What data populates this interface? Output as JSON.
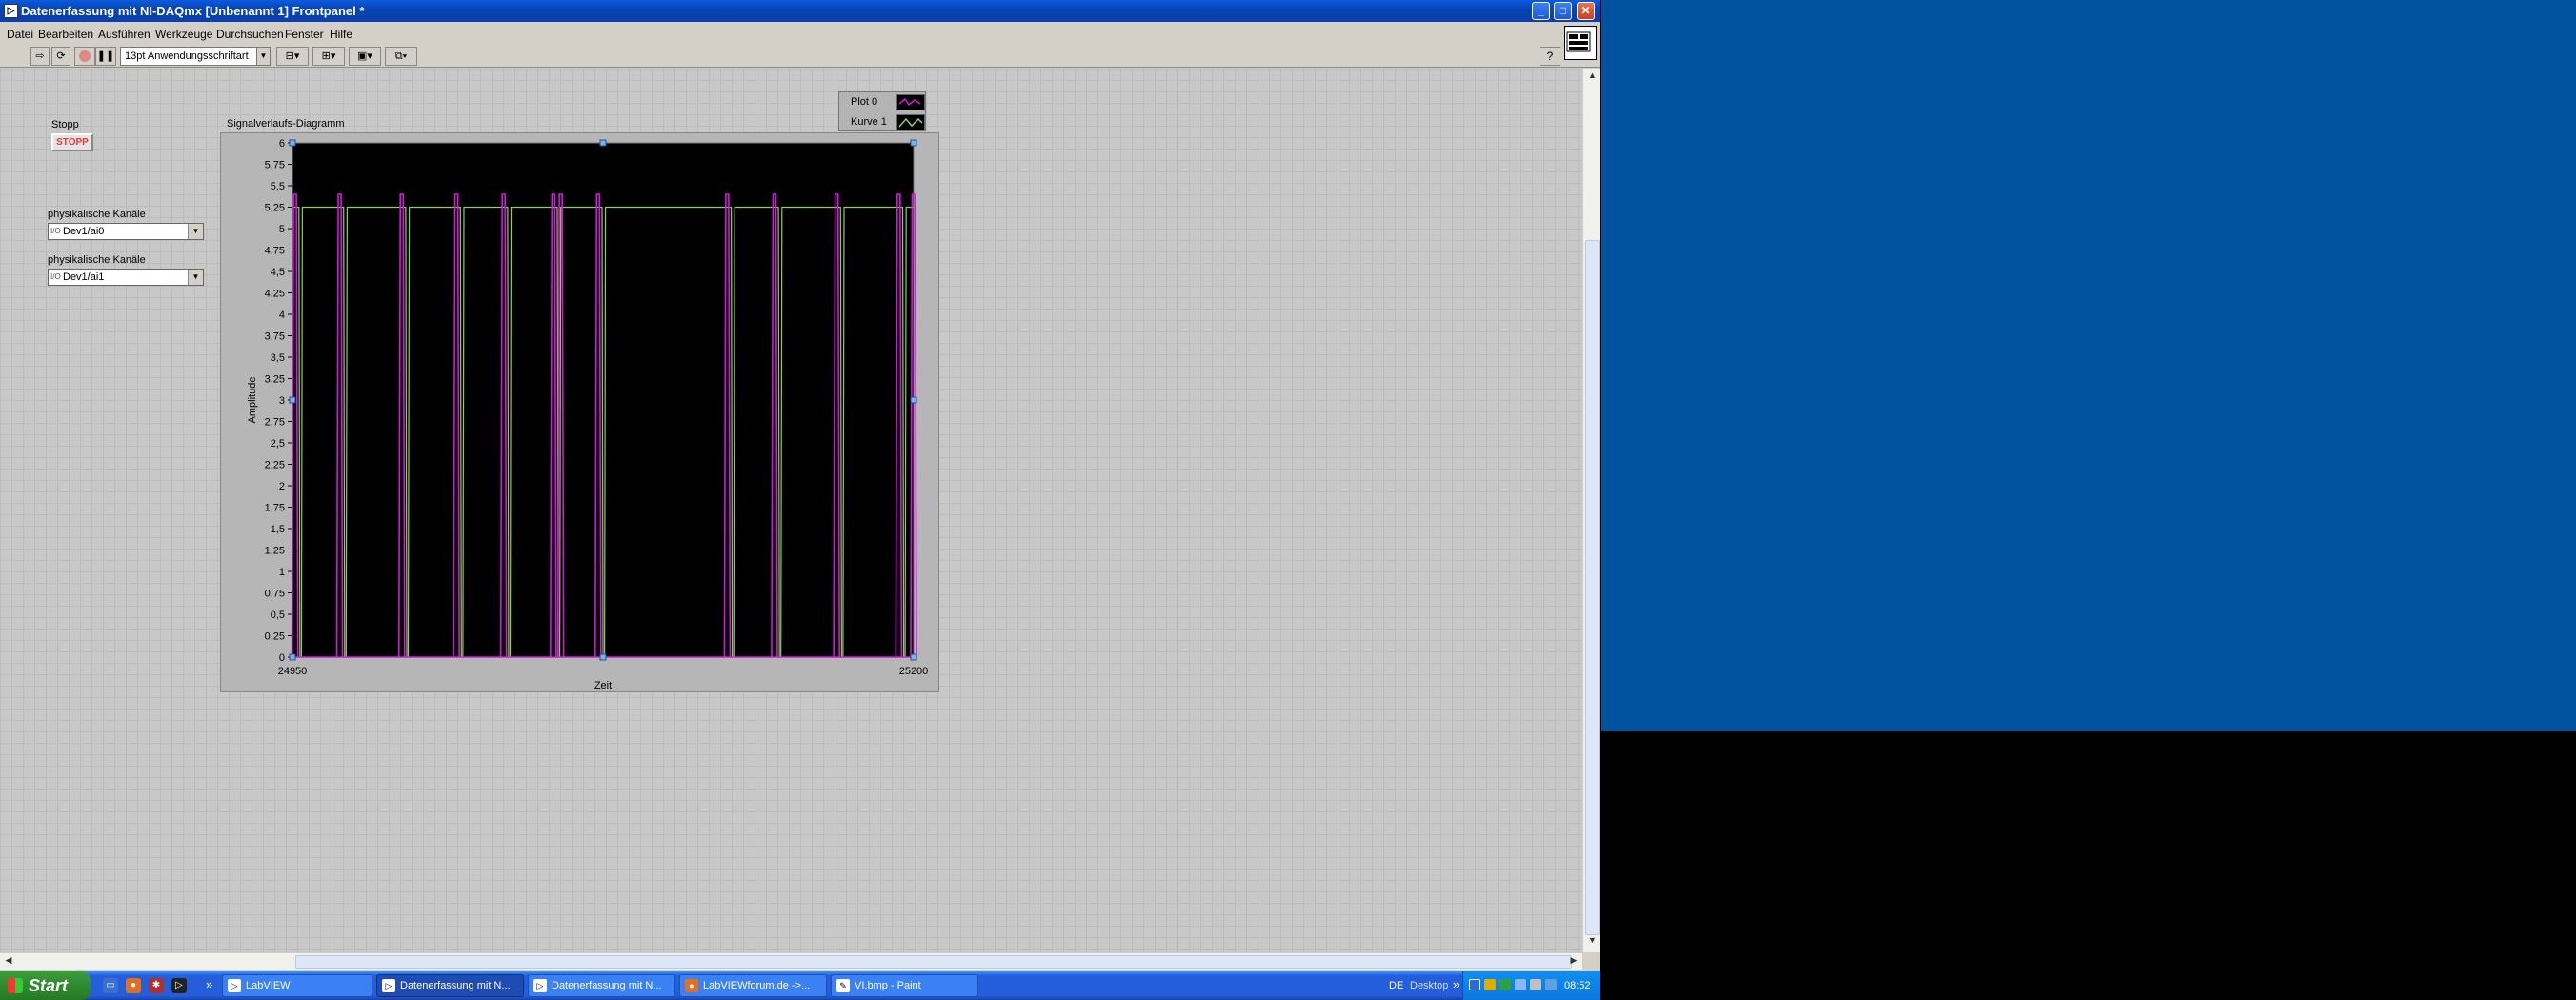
{
  "window": {
    "title": "Datenerfassung mit NI-DAQmx [Unbenannt 1] Frontpanel *",
    "controls": {
      "minimize": "_",
      "maximize": "□",
      "close": "✕"
    }
  },
  "menu": [
    "Datei",
    "Bearbeiten",
    "Ausführen",
    "Werkzeuge",
    "Durchsuchen",
    "Fenster",
    "Hilfe"
  ],
  "toolbar": {
    "font": "13pt Anwendungsschriftart",
    "icons": [
      "run-arrow-icon",
      "run-continuous-icon",
      "abort-icon",
      "pause-icon",
      "align-icon",
      "distribute-icon",
      "resize-icon",
      "reorder-icon"
    ],
    "help": "?"
  },
  "front_panel": {
    "stop_label": "Stopp",
    "stop_button": "STOPP",
    "channel1_label": "physikalische Kanäle",
    "channel1_value": "Dev1/ai0",
    "channel2_label": "physikalische Kanäle",
    "channel2_value": "Dev1/ai1",
    "io_symbol": "I/O"
  },
  "graph": {
    "label": "Signalverlaufs-Diagramm",
    "legend": [
      {
        "name": "Plot 0",
        "color": "#d01adc"
      },
      {
        "name": "Kurve 1",
        "color": "#8ed05a"
      }
    ]
  },
  "chart_data": {
    "type": "line",
    "title": "Signalverlaufs-Diagramm",
    "xlabel": "Zeit",
    "ylabel": "Amplitude",
    "xlim": [
      24950,
      25200
    ],
    "ylim": [
      0,
      6
    ],
    "x_ticks": [
      "24950",
      "25200"
    ],
    "y_ticks": [
      "0",
      "0,25",
      "0,5",
      "0,75",
      "1",
      "1,25",
      "1,5",
      "1,75",
      "2",
      "2,25",
      "2,5",
      "2,75",
      "3",
      "3,25",
      "3,5",
      "3,75",
      "4",
      "4,25",
      "4,5",
      "4,75",
      "5",
      "5,25",
      "5,5",
      "5,75",
      "6"
    ],
    "background": "#000000",
    "grid": false,
    "series": [
      {
        "name": "Plot 0",
        "color": "#d01adc",
        "spike_x": [
          24951,
          24969,
          24994,
          25016,
          25035,
          25055,
          25058,
          25073,
          25125,
          25144,
          25169,
          25194,
          25200
        ],
        "spike_peak": 5.4,
        "baseline": 0
      },
      {
        "name": "Kurve 1",
        "color": "#8ed05a",
        "baseline": 5.25,
        "dips_x": [
          24953,
          24971,
          24996,
          25018,
          25037,
          25057,
          25075,
          25127,
          25146,
          25171,
          25196
        ],
        "dip_low": 0
      }
    ]
  },
  "taskbar": {
    "start": "Start",
    "tasks": [
      {
        "label": "LabVIEW",
        "icon": "labview-icon",
        "active": false
      },
      {
        "label": "Datenerfassung mit N...",
        "icon": "labview-vi-icon",
        "active": true
      },
      {
        "label": "Datenerfassung mit N...",
        "icon": "labview-vi-icon",
        "active": false
      },
      {
        "label": "LabVIEWforum.de ->...",
        "icon": "firefox-icon",
        "active": false
      },
      {
        "label": "VI.bmp - Paint",
        "icon": "paint-icon",
        "active": false
      }
    ],
    "language": "DE",
    "desktop": "Desktop",
    "clock": "08:52",
    "overflow": "»"
  }
}
